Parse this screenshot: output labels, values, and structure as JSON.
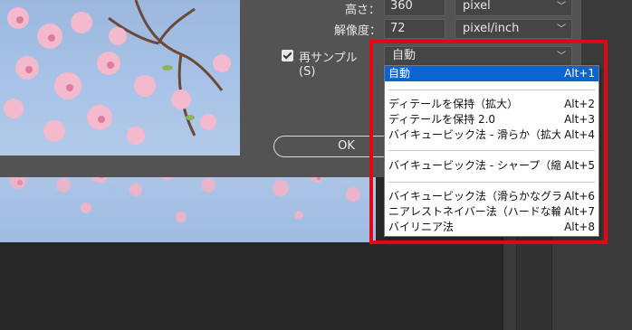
{
  "dialog": {
    "height_label": "高さ：",
    "height_value": "360",
    "height_unit": "pixel",
    "resolution_label": "解像度：",
    "resolution_value": "72",
    "resolution_unit": "pixel/inch",
    "resample_label": "再サンプル(S)",
    "resample_checked": true,
    "resample_value": "自動",
    "ok_label": "OK"
  },
  "dropdown": {
    "items": [
      {
        "label": "自動",
        "shortcut": "Alt+1",
        "selected": true
      },
      {
        "label": "ディテールを保持（拡大）",
        "shortcut": "Alt+2"
      },
      {
        "label": "ディテールを保持 2.0",
        "shortcut": "Alt+3"
      },
      {
        "label": "バイキュービック法 - 滑らか（拡大）",
        "shortcut": "Alt+4"
      },
      {
        "label": "バイキュービック法 - シャープ（縮小）",
        "shortcut": "Alt+5"
      },
      {
        "label": "バイキュービック法（滑らかなグラデーション）",
        "shortcut": "Alt+6"
      },
      {
        "label": "ニアレストネイバー法（ハードな輪郭）",
        "shortcut": "Alt+7"
      },
      {
        "label": "バイリニア法",
        "shortcut": "Alt+8"
      }
    ]
  },
  "colors": {
    "selection": "#0a64d2",
    "highlight_frame": "#e30613",
    "dialog_bg": "#535353"
  }
}
